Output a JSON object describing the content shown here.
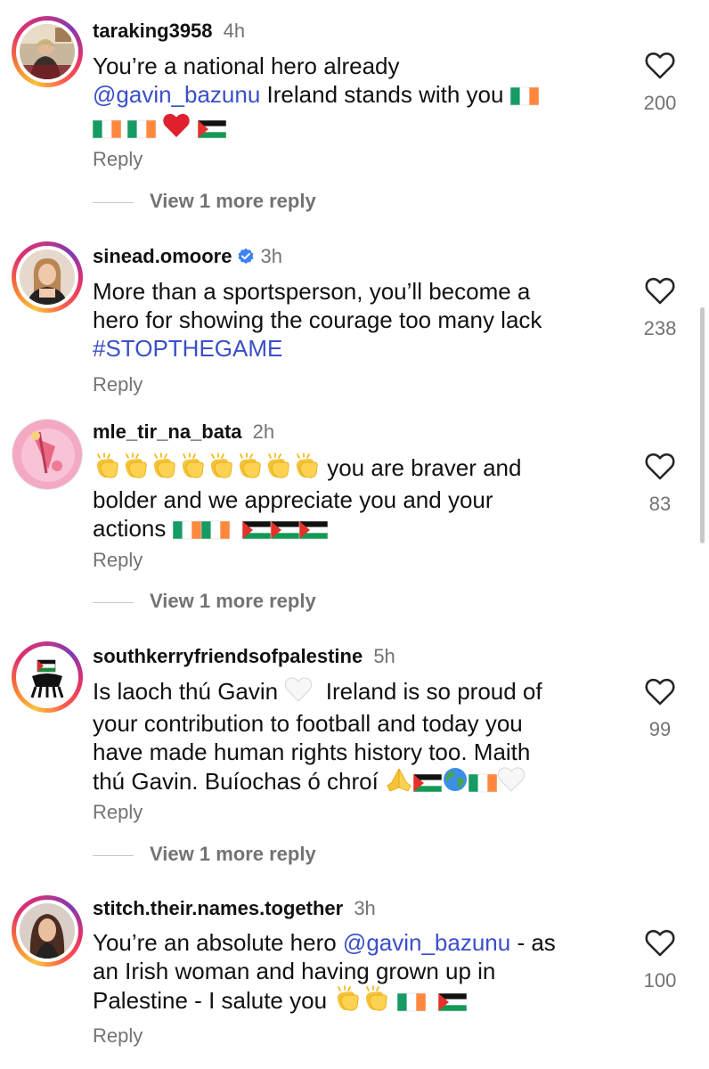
{
  "comments": [
    {
      "username": "taraking3958",
      "time": "4h",
      "verified": false,
      "lines": [
        [
          {
            "t": "You’re a national hero already"
          }
        ],
        [
          {
            "t": "@gavin_bazunu",
            "c": "mention"
          },
          {
            "t": " Ireland stands with you "
          },
          {
            "e": "flag-ireland"
          }
        ],
        [
          {
            "e": "flag-ireland"
          },
          {
            "t": " "
          },
          {
            "e": "flag-ireland"
          },
          {
            "t": " "
          },
          {
            "e": "red-heart"
          },
          {
            "t": " "
          },
          {
            "e": "flag-palestine"
          }
        ]
      ],
      "likes": "200",
      "reply_label": "Reply",
      "view_more": "View 1 more reply"
    },
    {
      "username": "sinead.omoore",
      "time": "3h",
      "verified": true,
      "lines": [
        [
          {
            "t": "More than a sportsperson, you’ll become a"
          }
        ],
        [
          {
            "t": "hero for showing the courage too many lack"
          }
        ],
        [
          {
            "t": "#STOPTHEGAME",
            "c": "hashtag"
          }
        ]
      ],
      "likes": "238",
      "reply_label": "Reply",
      "view_more": ""
    },
    {
      "username": "mle_tir_na_bata",
      "time": "2h",
      "verified": false,
      "lines": [
        [
          {
            "e": "clap"
          },
          {
            "e": "clap"
          },
          {
            "e": "clap"
          },
          {
            "e": "clap"
          },
          {
            "e": "clap"
          },
          {
            "e": "clap"
          },
          {
            "e": "clap"
          },
          {
            "e": "clap"
          },
          {
            "t": " you are braver and"
          }
        ],
        [
          {
            "t": "bolder and we appreciate you and your"
          }
        ],
        [
          {
            "t": "actions "
          },
          {
            "e": "flag-ireland"
          },
          {
            "e": "flag-ireland"
          },
          {
            "t": "  "
          },
          {
            "e": "flag-palestine"
          },
          {
            "e": "flag-palestine"
          },
          {
            "e": "flag-palestine"
          }
        ]
      ],
      "likes": "83",
      "reply_label": "Reply",
      "view_more": "View 1 more reply"
    },
    {
      "username": "southkerryfriendsofpalestine",
      "time": "5h",
      "verified": false,
      "lines": [
        [
          {
            "t": "Is laoch thú Gavin "
          },
          {
            "e": "white-heart"
          },
          {
            "t": "  Ireland is so proud of"
          }
        ],
        [
          {
            "t": "your contribution to football and today you"
          }
        ],
        [
          {
            "t": "have made human rights history too. Maith"
          }
        ],
        [
          {
            "t": "thú Gavin. Buíochas ó chroí "
          },
          {
            "e": "folded-hands"
          },
          {
            "e": "flag-palestine"
          },
          {
            "e": "globe"
          },
          {
            "e": "flag-ireland"
          },
          {
            "e": "white-heart"
          }
        ]
      ],
      "likes": "99",
      "reply_label": "Reply",
      "view_more": "View 1 more reply"
    },
    {
      "username": "stitch.their.names.together",
      "time": "3h",
      "verified": false,
      "lines": [
        [
          {
            "t": "You’re an absolute hero "
          },
          {
            "t": "@gavin_bazunu",
            "c": "mention"
          },
          {
            "t": " - as"
          }
        ],
        [
          {
            "t": "an Irish woman and having grown up in"
          }
        ],
        [
          {
            "t": "Palestine - I salute you "
          },
          {
            "e": "clap"
          },
          {
            "e": "clap"
          },
          {
            "t": " "
          },
          {
            "e": "flag-ireland"
          },
          {
            "t": "  "
          },
          {
            "e": "flag-palestine"
          }
        ]
      ],
      "likes": "100",
      "reply_label": "Reply",
      "view_more": ""
    }
  ],
  "colors": {
    "mention": "#3a4fc8",
    "secondary_text": "#737373",
    "verified_badge": "#3b82f6",
    "story_ring": [
      "#f9c23c",
      "#e1306c",
      "#833ab4"
    ]
  }
}
